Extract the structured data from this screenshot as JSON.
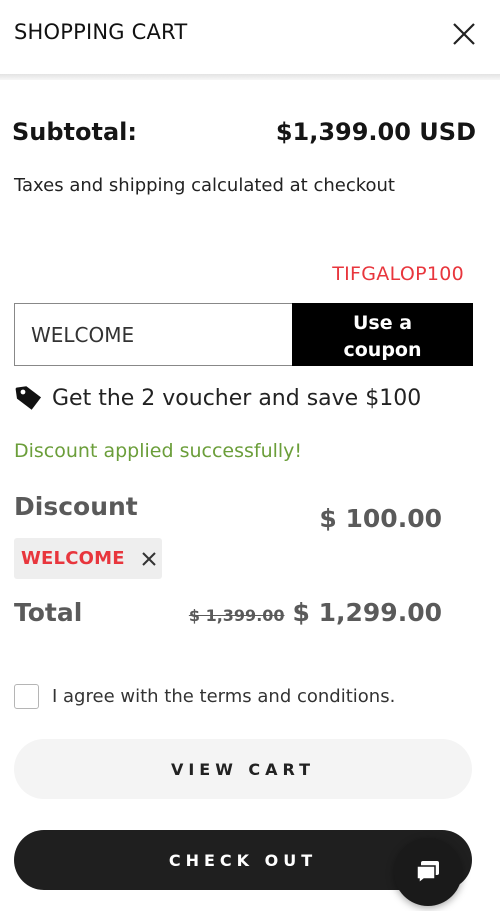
{
  "header": {
    "title": "SHOPPING CART",
    "close_icon": "close-icon"
  },
  "summary": {
    "subtotal_label": "Subtotal:",
    "subtotal_value": "$1,399.00 USD",
    "tax_note": "Taxes and shipping calculated at checkout"
  },
  "coupon": {
    "hint_code": "TIFGALOP100",
    "input_value": "WELCOME",
    "button_label_line1": "Use a",
    "button_label_line2": "coupon",
    "voucher_icon": "tag-icon",
    "voucher_text": "Get the 2 voucher and save $100",
    "success_message": "Discount applied successfully!",
    "hint_color": "#e8363d",
    "success_color": "#6b9e3a"
  },
  "discount": {
    "label": "Discount",
    "value": "$ 100.00",
    "applied_code": "WELCOME",
    "remove_icon": "close-icon"
  },
  "total": {
    "label": "Total",
    "original_price": "$ 1,399.00",
    "final_price": "$ 1,299.00"
  },
  "terms": {
    "checked": false,
    "label": "I agree with the terms and conditions."
  },
  "actions": {
    "view_cart_label": "VIEW CART",
    "checkout_label": "CHECK OUT"
  },
  "chat": {
    "icon": "chat-icon"
  }
}
